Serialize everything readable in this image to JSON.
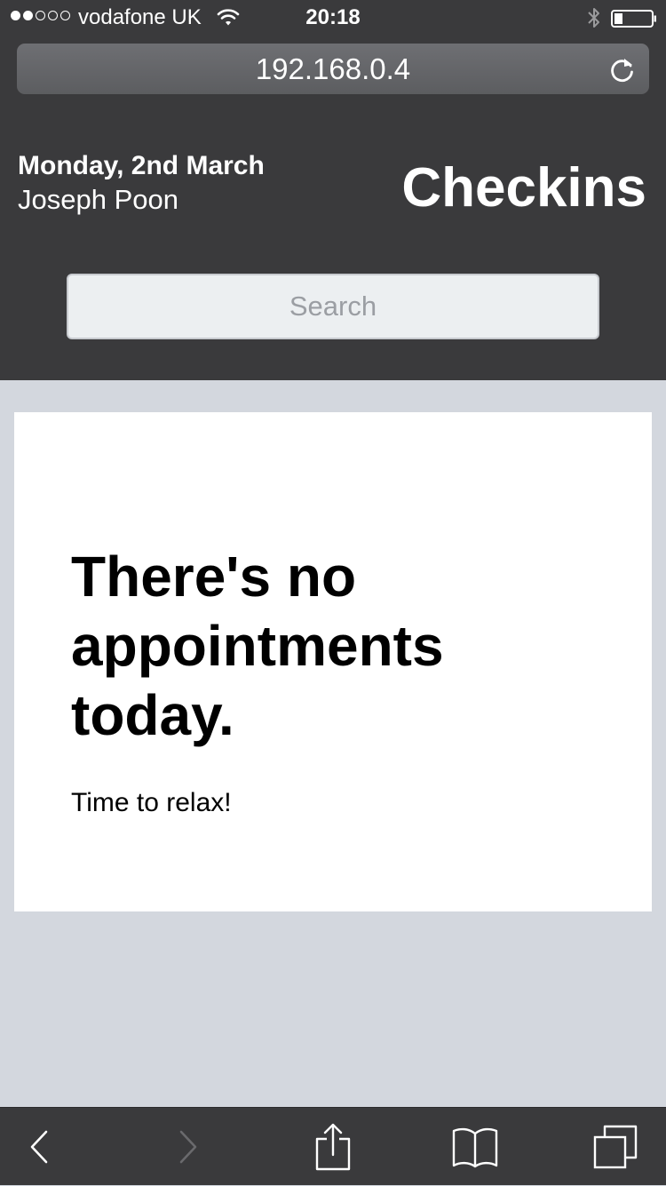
{
  "status_bar": {
    "carrier": "vodafone UK",
    "time": "20:18",
    "signal_bars_filled": 2,
    "signal_bars_total": 5,
    "icons": [
      "wifi-icon",
      "bluetooth-icon",
      "battery-icon"
    ]
  },
  "browser": {
    "url": "192.168.0.4",
    "icons": [
      "reload-icon",
      "back-icon",
      "forward-icon",
      "share-icon",
      "bookmarks-icon",
      "tabs-icon"
    ]
  },
  "header": {
    "date": "Monday, 2nd March",
    "user": "Joseph Poon",
    "title": "Checkins"
  },
  "search": {
    "placeholder": "Search",
    "value": ""
  },
  "empty_state": {
    "heading": "There's no appointments today.",
    "subtext": "Time to relax!"
  },
  "colors": {
    "header_background": "#3a3a3c",
    "page_background": "#d3d7de",
    "card_background": "#ffffff",
    "search_background": "#eceff1"
  }
}
